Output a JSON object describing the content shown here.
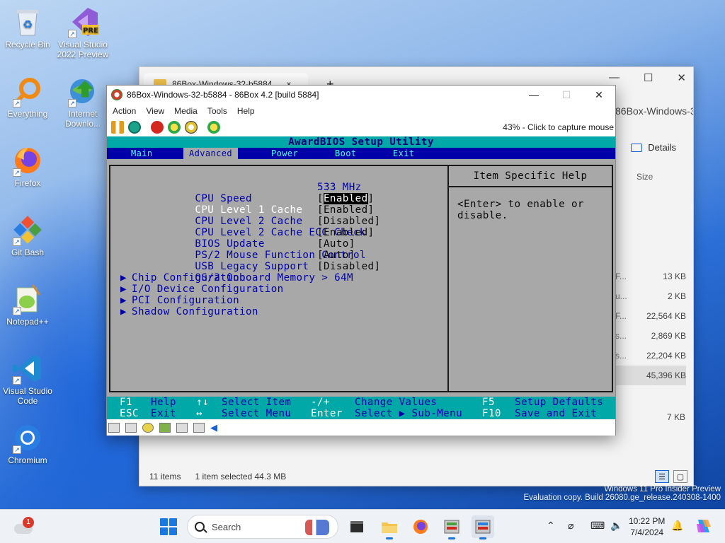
{
  "desktop": {
    "icons": [
      {
        "label": "Recycle Bin",
        "icon": "recycle-bin-icon"
      },
      {
        "label": "Visual Studio 2022 Preview",
        "icon": "visual-studio-icon",
        "badge": "PRE"
      },
      {
        "label": "Everything",
        "icon": "everything-search-icon"
      },
      {
        "label": "Internet Downlo...",
        "icon": "internet-download-manager-icon"
      },
      {
        "label": "Firefox",
        "icon": "firefox-icon"
      },
      {
        "label": "Git Bash",
        "icon": "git-bash-icon"
      },
      {
        "label": "Notepad++",
        "icon": "notepadpp-icon"
      },
      {
        "label": "Visual Studio Code",
        "icon": "vscode-icon"
      },
      {
        "label": "Chromium",
        "icon": "chromium-icon"
      }
    ],
    "watermark": {
      "line1": "Windows 11 Pro Insider Preview",
      "line2": "Evaluation copy. Build 26080.ge_release.240308-1400"
    }
  },
  "explorer": {
    "tab_title": "86Box-Windows-32-b5884",
    "tab_close": "×",
    "tab_add": "+",
    "breadcrumb": "86Box-Windows-3",
    "details_label": "Details",
    "size_header": "Size",
    "sizes": [
      {
        "prefix": "F...",
        "size": "13 KB"
      },
      {
        "prefix": "u...",
        "size": "2 KB"
      },
      {
        "prefix": "F...",
        "size": "22,564 KB"
      },
      {
        "prefix": "s...",
        "size": "2,869 KB"
      },
      {
        "prefix": "s...",
        "size": "22,204 KB"
      },
      {
        "prefix": "",
        "size": "45,396 KB",
        "selected": true
      }
    ],
    "last_size": "7 KB",
    "status_items": "11 items",
    "status_selected": "1 item selected  44.3 MB"
  },
  "vm": {
    "title": "86Box-Windows-32-b5884 - 86Box 4.2 [build 5884]",
    "menu": [
      "Action",
      "View",
      "Media",
      "Tools",
      "Help"
    ],
    "capture_hint": "43% - Click to capture mouse",
    "toolbar_icons": [
      "pause-icon",
      "reset-icon",
      "power-icon",
      "settings-icon",
      "hard-reset-icon",
      "screenshot-icon"
    ],
    "statusbar_icons": [
      "floppy-a-icon",
      "floppy-b-icon",
      "cdrom-icon",
      "hdd-icon",
      "network-icon",
      "network2-icon",
      "sound-icon"
    ]
  },
  "bios": {
    "title": "AwardBIOS Setup Utility",
    "menu": [
      {
        "label": "Main",
        "selected": false
      },
      {
        "label": "Advanced",
        "selected": true
      },
      {
        "label": "Power",
        "selected": false
      },
      {
        "label": "Boot",
        "selected": false
      },
      {
        "label": "Exit",
        "selected": false
      }
    ],
    "items": [
      {
        "label": "CPU Speed",
        "value": "533 MHz",
        "highlight": false
      },
      {
        "label": "CPU Level 1 Cache",
        "value": "Enabled",
        "bracket": true,
        "highlight": true,
        "selected_value": true
      },
      {
        "label": "CPU Level 2 Cache",
        "value": "[Enabled]",
        "highlight": false
      },
      {
        "label": "CPU Level 2 Cache ECC Check",
        "value": "[Disabled]",
        "highlight": false
      },
      {
        "label": "BIOS Update",
        "value": "[Enabled]",
        "highlight": false
      },
      {
        "label": "PS/2 Mouse Function Control",
        "value": "[Auto]",
        "highlight": false
      },
      {
        "label": "USB Legacy Support",
        "value": "[Auto]",
        "highlight": false
      },
      {
        "label": "OS/2 Onboard Memory > 64M",
        "value": "[Disabled]",
        "highlight": false
      }
    ],
    "submenus": [
      "Chip Configuration",
      "I/O Device Configuration",
      "PCI Configuration",
      "Shadow Configuration"
    ],
    "help_title": "Item Specific Help",
    "help_text": "<Enter> to enable or\ndisable.",
    "footer": {
      "f1_key": "F1",
      "f1_label": "Help",
      "updown_key": "↑↓",
      "updown_label": "Select Item",
      "minusplus_key": "-/+",
      "minusplus_label": "Change Values",
      "f5_key": "F5",
      "f5_label": "Setup Defaults",
      "esc_key": "ESC",
      "esc_label": "Exit",
      "leftright_key": "↔",
      "leftright_label": "Select Menu",
      "enter_key": "Enter",
      "enter_label": "Select ▶ Sub-Menu",
      "f10_key": "F10",
      "f10_label": "Save and Exit"
    }
  },
  "taskbar": {
    "search_placeholder": "Search",
    "notification_count": "1",
    "time": "10:22 PM",
    "date": "7/4/2024",
    "apps": [
      "file-explorer-icon",
      "firefox-icon",
      "86box-icon",
      "86box-window-icon"
    ]
  }
}
